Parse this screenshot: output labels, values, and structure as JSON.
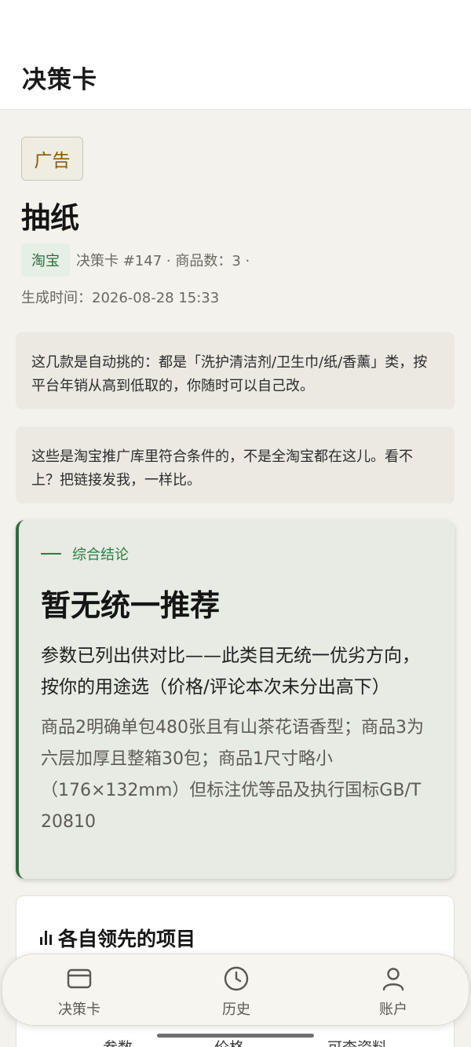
{
  "header": {
    "title": "决策卡"
  },
  "ad_badge": "广告",
  "product": {
    "title": "抽纸",
    "platform": "淘宝",
    "meta": "决策卡 #147 · 商品数：3 ·",
    "generated": "生成时间：2026-08-28 15:33"
  },
  "notes": [
    "这几款是自动挑的：都是「洗护清洁剂/卫生巾/纸/香薰」类，按平台年销从高到低取的，你随时可以自己改。",
    "这些是淘宝推广库里符合条件的，不是全淘宝都在这儿。看不上？把链接发我，一样比。"
  ],
  "verdict": {
    "eyebrow": "综合结论",
    "headline": "暂无统一推荐",
    "lead": "参数已列出供对比——此类目无统一优劣方向，按你的用途选（价格/评论本次未分出高下）",
    "detail": "商品2明确单包480张且有山茶花语香型；商品3为六层加厚且整箱30包；商品1尺寸略小（176×132mm）但标注优等品及执行国标GB/T 20810"
  },
  "leading": {
    "title": "各自领先的项目",
    "icon": "bar-chart-icon",
    "columns": [
      "参数",
      "价格",
      "可查资料"
    ]
  },
  "bottom_nav": {
    "items": [
      {
        "label": "决策卡",
        "icon": "card-icon"
      },
      {
        "label": "历史",
        "icon": "clock-icon"
      },
      {
        "label": "账户",
        "icon": "person-icon"
      }
    ]
  }
}
